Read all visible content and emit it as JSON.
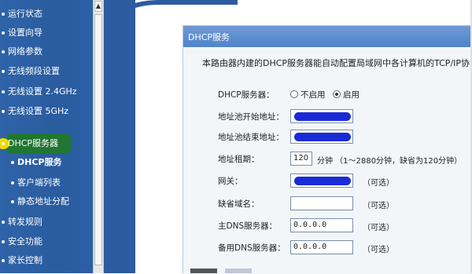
{
  "nav": {
    "items": [
      {
        "label": "运行状态",
        "type": "main"
      },
      {
        "label": "设置向导",
        "type": "main"
      },
      {
        "label": "网络参数",
        "type": "main"
      },
      {
        "label": "无线频段设置",
        "type": "main"
      },
      {
        "label": "无线设置 2.4GHz",
        "type": "main"
      },
      {
        "label": "无线设置 5GHz",
        "type": "main"
      },
      {
        "label": "DHCP服务器",
        "type": "main",
        "highlighted": true
      },
      {
        "label": "DHCP服务",
        "type": "sub",
        "active": true
      },
      {
        "label": "客户端列表",
        "type": "sub"
      },
      {
        "label": "静态地址分配",
        "type": "sub"
      },
      {
        "label": "转发规则",
        "type": "main"
      },
      {
        "label": "安全功能",
        "type": "main"
      },
      {
        "label": "家长控制",
        "type": "main"
      }
    ],
    "highlight_color": "#1f7a1f",
    "pointer_color": "#f5d800",
    "bg_color": "#2a5c9f"
  },
  "scrollbar": {
    "up_arrow": "▲"
  },
  "panel": {
    "title": "DHCP服务",
    "intro": "本路由器内建的DHCP服务器能自动配置局域网中各计算机的TCP/IP协议。",
    "dhcp_server": {
      "label": "DHCP服务器：",
      "options": [
        {
          "label": "不启用",
          "selected": false
        },
        {
          "label": "启用",
          "selected": true
        }
      ]
    },
    "start_address": {
      "label": "地址池开始地址："
    },
    "end_address": {
      "label": "地址池结束地址："
    },
    "lease": {
      "label": "地址租期：",
      "value": "120",
      "unit": "分钟 （1～2880分钟，缺省为120分钟）"
    },
    "gateway": {
      "label": "网关：",
      "hint": "（可选）"
    },
    "domain": {
      "label": "缺省域名：",
      "value": "",
      "hint": "（可选）"
    },
    "primary_dns": {
      "label": "主DNS服务器：",
      "value": "0.0.0.0",
      "hint": "（可选）"
    },
    "secondary_dns": {
      "label": "备用DNS服务器：",
      "value": "0.0.0.0",
      "hint": "（可选）"
    },
    "title_bar_color": "#4f84c9",
    "redaction_color": "#1a2bd6"
  }
}
